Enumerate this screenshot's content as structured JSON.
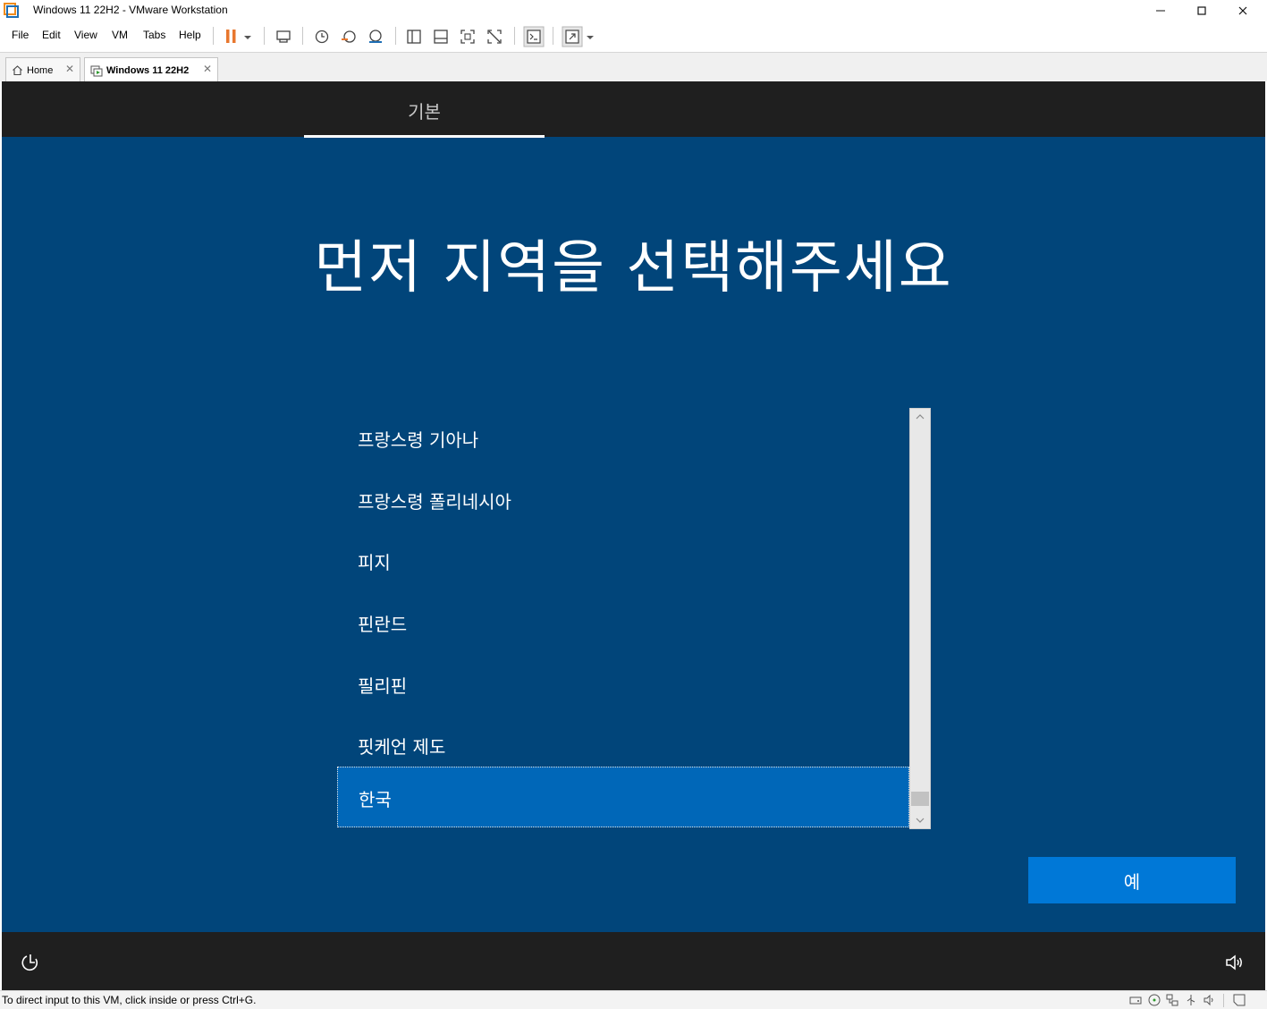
{
  "window": {
    "title": "Windows 11 22H2 - VMware Workstation",
    "minimize": "—",
    "maximize": "☐",
    "close": "✕"
  },
  "menu": {
    "file": "File",
    "edit": "Edit",
    "view": "View",
    "vm": "VM",
    "tabs": "Tabs",
    "help": "Help"
  },
  "tabs": [
    {
      "label": "Home",
      "active": false
    },
    {
      "label": "Windows 11 22H2",
      "active": true
    }
  ],
  "oobe": {
    "section_tab": "기본",
    "headline": "먼저 지역을 선택해주세요",
    "regions": [
      {
        "label": "프랑스령 기아나",
        "selected": false
      },
      {
        "label": "프랑스령 폴리네시아",
        "selected": false
      },
      {
        "label": "피지",
        "selected": false
      },
      {
        "label": "핀란드",
        "selected": false
      },
      {
        "label": "필리핀",
        "selected": false
      },
      {
        "label": "핏케언 제도",
        "selected": false
      },
      {
        "label": "한국",
        "selected": true
      }
    ],
    "yes_button": "예"
  },
  "status": {
    "text": "To direct input to this VM, click inside or press Ctrl+G."
  },
  "colors": {
    "vm_background": "#01457a",
    "selected_item": "#0067b8",
    "primary_button": "#0078d7",
    "pause_accent": "#e8772e"
  }
}
